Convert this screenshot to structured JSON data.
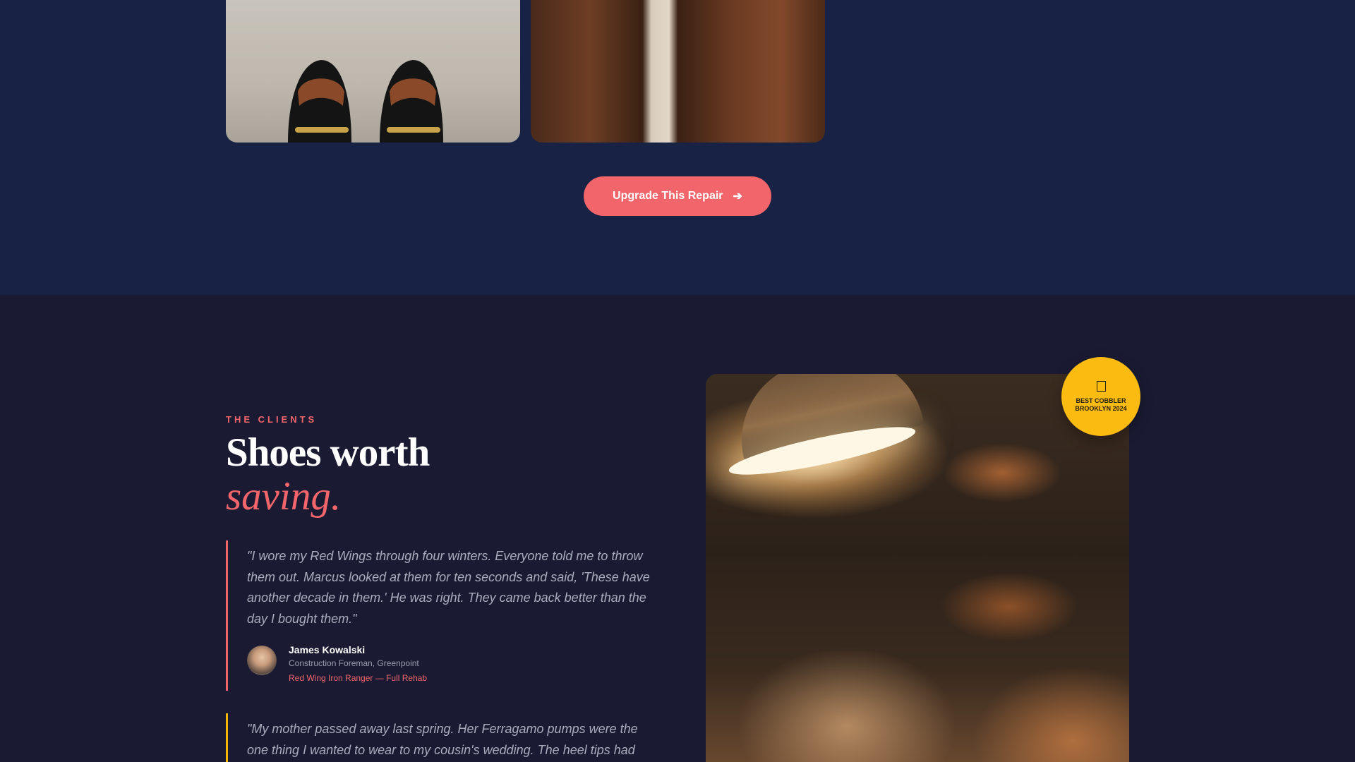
{
  "gallery": {
    "images": [
      {
        "name": "black-horsebit-loafers"
      },
      {
        "name": "brown-leather-boots"
      }
    ]
  },
  "cta": {
    "label": "Upgrade This Repair",
    "icon": "arrow-right-icon",
    "color": "#f2656a"
  },
  "clients": {
    "eyebrow": "THE CLIENTS",
    "headline": "Shoes worth",
    "headline_accent": "saving.",
    "testimonials": [
      {
        "quote": "\"I wore my Red Wings through four winters. Everyone told me to throw them out. Marcus looked at them for ten seconds and said, 'These have another decade in them.' He was right. They came back better than the day I bought them.\"",
        "name": "James Kowalski",
        "role": "Construction Foreman, Greenpoint",
        "shoe": "Red Wing Iron Ranger — Full Rehab",
        "accent": "#f2656a"
      },
      {
        "quote": "\"My mother passed away last spring. Her Ferragamo pumps were the one thing I wanted to wear to my cousin's wedding. The heel tips had",
        "accent": "#f5b800"
      }
    ]
  },
  "award": {
    "icon": "award-icon",
    "text": "BEST COBBLER BROOKLYN 2024",
    "color": "#fbbb10"
  },
  "colors": {
    "top_bg": "#172244",
    "section_bg": "#1a1b33",
    "accent": "#f2656a",
    "gold": "#fbbb10"
  }
}
